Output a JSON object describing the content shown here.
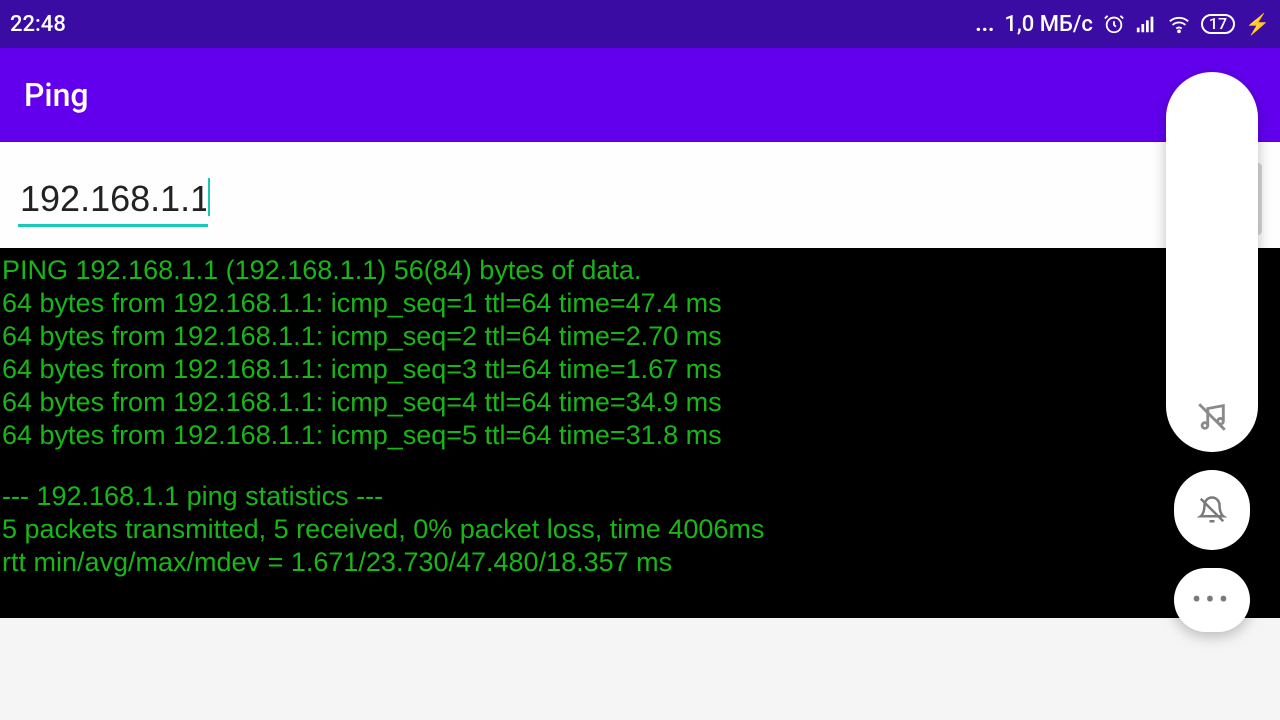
{
  "status_bar": {
    "time": "22:48",
    "net_speed": "1,0 МБ/с",
    "battery": "17"
  },
  "app_bar": {
    "title": "Ping"
  },
  "input": {
    "ip_value": "192.168.1.1"
  },
  "terminal": {
    "lines": [
      "PING 192.168.1.1 (192.168.1.1) 56(84) bytes of data.",
      "64 bytes from 192.168.1.1: icmp_seq=1 ttl=64 time=47.4 ms",
      "64 bytes from 192.168.1.1: icmp_seq=2 ttl=64 time=2.70 ms",
      "64 bytes from 192.168.1.1: icmp_seq=3 ttl=64 time=1.67 ms",
      "64 bytes from 192.168.1.1: icmp_seq=4 ttl=64 time=34.9 ms",
      "64 bytes from 192.168.1.1: icmp_seq=5 ttl=64 time=31.8 ms",
      "",
      "--- 192.168.1.1 ping statistics ---",
      "5 packets transmitted, 5 received, 0% packet loss, time 4006ms",
      "rtt min/avg/max/mdev = 1.671/23.730/47.480/18.357 ms"
    ]
  },
  "ping_data": {
    "target": "192.168.1.1",
    "bytes_sent": 56,
    "bytes_total": 84,
    "replies": [
      {
        "bytes": 64,
        "from": "192.168.1.1",
        "icmp_seq": 1,
        "ttl": 64,
        "time_ms": 47.4
      },
      {
        "bytes": 64,
        "from": "192.168.1.1",
        "icmp_seq": 2,
        "ttl": 64,
        "time_ms": 2.7
      },
      {
        "bytes": 64,
        "from": "192.168.1.1",
        "icmp_seq": 3,
        "ttl": 64,
        "time_ms": 1.67
      },
      {
        "bytes": 64,
        "from": "192.168.1.1",
        "icmp_seq": 4,
        "ttl": 64,
        "time_ms": 34.9
      },
      {
        "bytes": 64,
        "from": "192.168.1.1",
        "icmp_seq": 5,
        "ttl": 64,
        "time_ms": 31.8
      }
    ],
    "stats": {
      "transmitted": 5,
      "received": 5,
      "loss_pct": 0,
      "time_ms": 4006,
      "rtt": {
        "min": 1.671,
        "avg": 23.73,
        "max": 47.48,
        "mdev": 18.357
      }
    }
  }
}
